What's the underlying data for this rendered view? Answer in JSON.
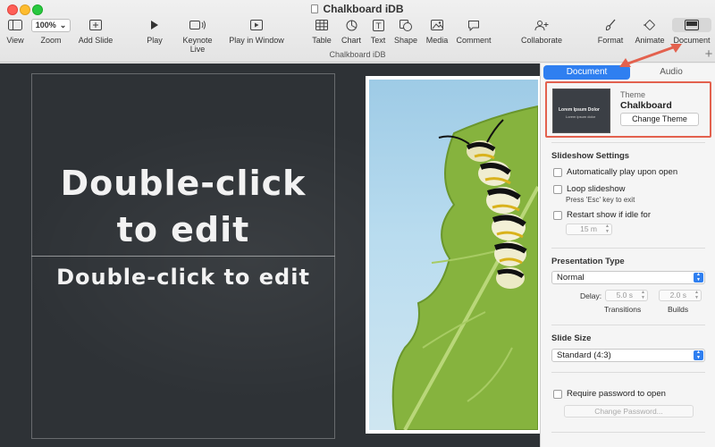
{
  "window": {
    "title": "Chalkboard iDB",
    "subtitle": "Chalkboard iDB"
  },
  "toolbar": {
    "view_label": "View",
    "zoom_value": "100%",
    "zoom_label": "Zoom",
    "add_slide_label": "Add Slide",
    "play_label": "Play",
    "keynote_live_label": "Keynote Live",
    "play_in_window_label": "Play in Window",
    "table_label": "Table",
    "chart_label": "Chart",
    "text_label": "Text",
    "shape_label": "Shape",
    "media_label": "Media",
    "comment_label": "Comment",
    "collaborate_label": "Collaborate",
    "format_label": "Format",
    "animate_label": "Animate",
    "document_label": "Document"
  },
  "slide": {
    "title_placeholder": "Double-click to edit",
    "body_placeholder": "Double-click to edit"
  },
  "inspector": {
    "tabs": [
      {
        "label": "Document",
        "active": true
      },
      {
        "label": "Audio",
        "active": false
      }
    ],
    "theme": {
      "caption": "Theme",
      "name": "Chalkboard",
      "change_button": "Change Theme",
      "thumb_title": "Lorem Ipsum Dolor",
      "thumb_sub": "Lorem ipsum dolor"
    },
    "slideshow": {
      "title": "Slideshow Settings",
      "autoplay_label": "Automatically play upon open",
      "loop_label": "Loop slideshow",
      "loop_hint": "Press 'Esc' key to exit",
      "restart_label": "Restart show if idle for",
      "idle_value": "15 m"
    },
    "presentation_type": {
      "title": "Presentation Type",
      "selected": "Normal",
      "delay_label": "Delay:",
      "transitions_value": "5.0 s",
      "builds_value": "2.0 s",
      "transitions_label": "Transitions",
      "builds_label": "Builds"
    },
    "slide_size": {
      "title": "Slide Size",
      "selected": "Standard (4:3)"
    },
    "password": {
      "require_label": "Require password to open",
      "change_button": "Change Password..."
    }
  },
  "colors": {
    "accent": "#2f7ff0",
    "annotation": "#e3614e",
    "canvas_bg": "#2e3236"
  }
}
